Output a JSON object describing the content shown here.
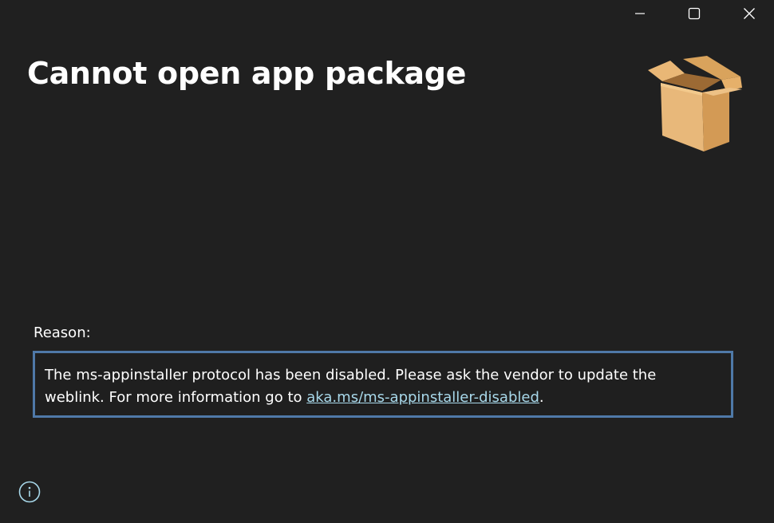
{
  "window": {
    "heading": "Cannot open app package"
  },
  "titlebar": {
    "minimize_icon": "minimize-icon",
    "maximize_icon": "maximize-icon",
    "close_icon": "close-icon"
  },
  "package": {
    "icon": "package-box-icon"
  },
  "reason": {
    "label": "Reason:",
    "message_part1": "The ms-appinstaller protocol has been disabled. Please ask the vendor to update the weblink. For more information go to ",
    "link_text": "aka.ms/ms-appinstaller-disabled",
    "message_end": "."
  },
  "footer": {
    "info_icon": "info-icon"
  },
  "colors": {
    "background": "#202020",
    "box_border": "#4f79a8",
    "link": "#a8d8ea",
    "text": "#ffffff"
  }
}
